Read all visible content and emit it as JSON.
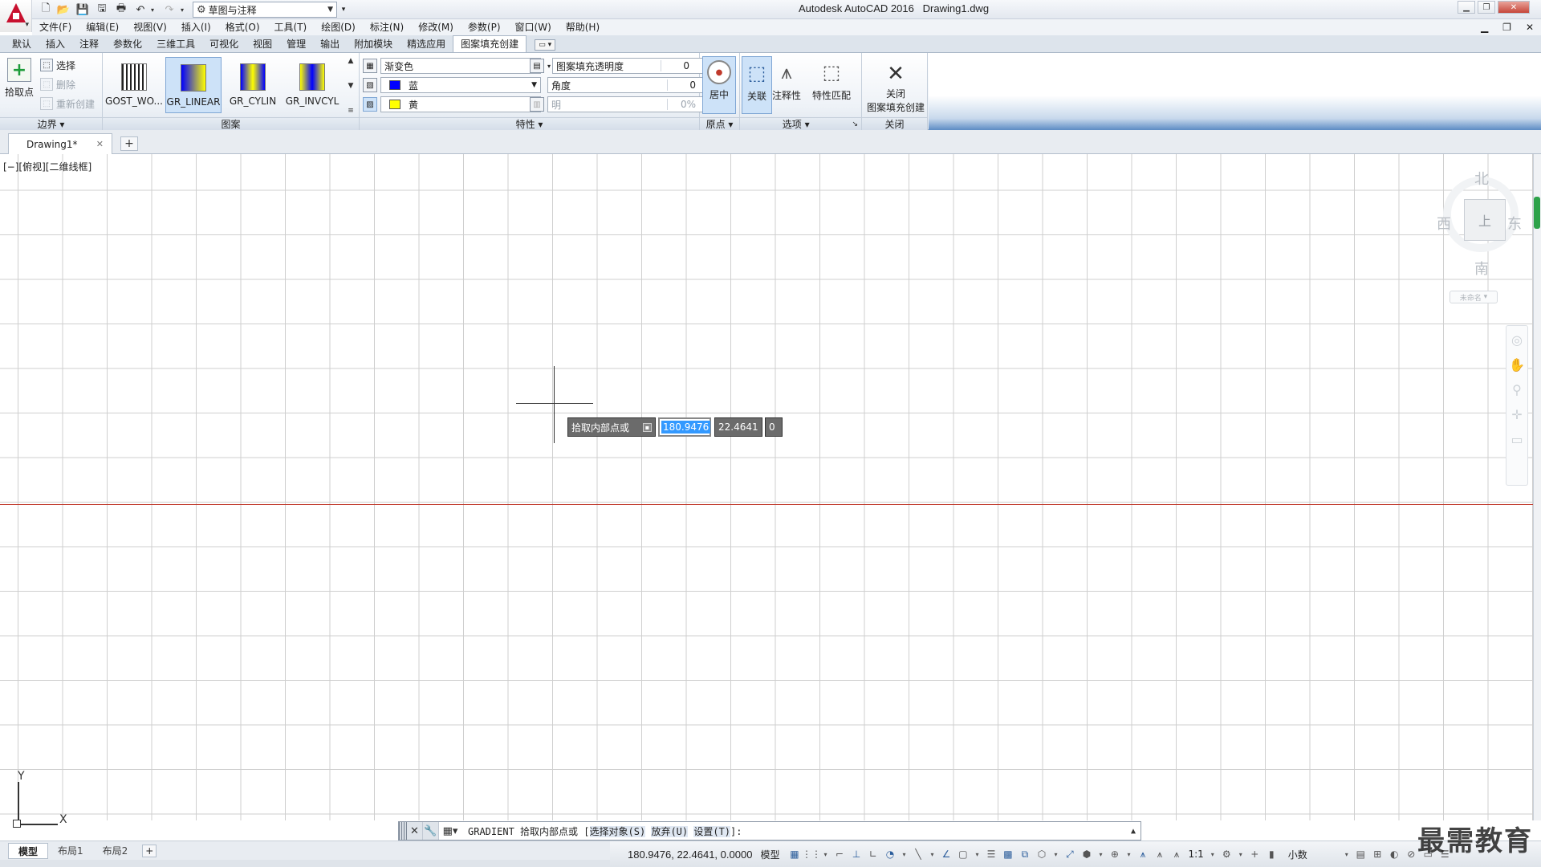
{
  "titlebar": {
    "workspace": "草图与注释",
    "app_name": "Autodesk AutoCAD 2016",
    "document": "Drawing1.dwg"
  },
  "menu": [
    "文件(F)",
    "编辑(E)",
    "视图(V)",
    "插入(I)",
    "格式(O)",
    "工具(T)",
    "绘图(D)",
    "标注(N)",
    "修改(M)",
    "参数(P)",
    "窗口(W)",
    "帮助(H)"
  ],
  "ribbon_tabs": [
    "默认",
    "插入",
    "注释",
    "参数化",
    "三维工具",
    "可视化",
    "视图",
    "管理",
    "输出",
    "附加模块",
    "精选应用",
    "图案填充创建"
  ],
  "ribbon_active_tab": "图案填充创建",
  "boundary_panel": {
    "title": "边界",
    "pick_points": "拾取点",
    "select": "选择",
    "remove": "删除",
    "recreate": "重新创建"
  },
  "pattern_panel": {
    "title": "图案",
    "patterns": [
      {
        "name": "GOST_WO...",
        "selected": false
      },
      {
        "name": "GR_LINEAR",
        "selected": true
      },
      {
        "name": "GR_CYLIN",
        "selected": false
      },
      {
        "name": "GR_INVCYL",
        "selected": false
      }
    ]
  },
  "properties_panel": {
    "title": "特性",
    "hatch_type": "渐变色",
    "color1_name": "蓝",
    "color1": "#0000ff",
    "color2_name": "黄",
    "color2": "#ffff00",
    "transparency_label": "图案填充透明度",
    "transparency_value": "0",
    "angle_label": "角度",
    "angle_value": "0",
    "tint_label": "明",
    "tint_value": "0%"
  },
  "origin_panel": {
    "title": "原点",
    "center": "居中"
  },
  "options_panel": {
    "title": "选项",
    "associative": "关联",
    "annotative": "注释性",
    "match_properties": "特性匹配"
  },
  "close_panel": {
    "title": "关闭",
    "close_line1": "关闭",
    "close_line2": "图案填充创建"
  },
  "doc_tab": "Drawing1*",
  "viewport_label": "[−][俯视][二维线框]",
  "viewcube": {
    "north": "北",
    "south": "南",
    "east": "东",
    "west": "西",
    "wcs": "未命名"
  },
  "dynamic_input": {
    "prompt": "拾取内部点或",
    "x": "180.9476",
    "y": "22.4641",
    "z": "0"
  },
  "ucs": {
    "x": "X",
    "y": "Y"
  },
  "command_line": {
    "command": "GRADIENT",
    "prompt": "拾取内部点或",
    "open_bracket": "[",
    "option1": "选择对象(S)",
    "option2": "放弃(U)",
    "option3": "设置(T)",
    "close_bracket": "]:"
  },
  "layout_tabs": [
    "模型",
    "布局1",
    "布局2"
  ],
  "status": {
    "coordinates": "180.9476, 22.4641, 0.0000",
    "space": "模型",
    "scale": "1:1",
    "units": "小数"
  },
  "watermark": "最需教育"
}
